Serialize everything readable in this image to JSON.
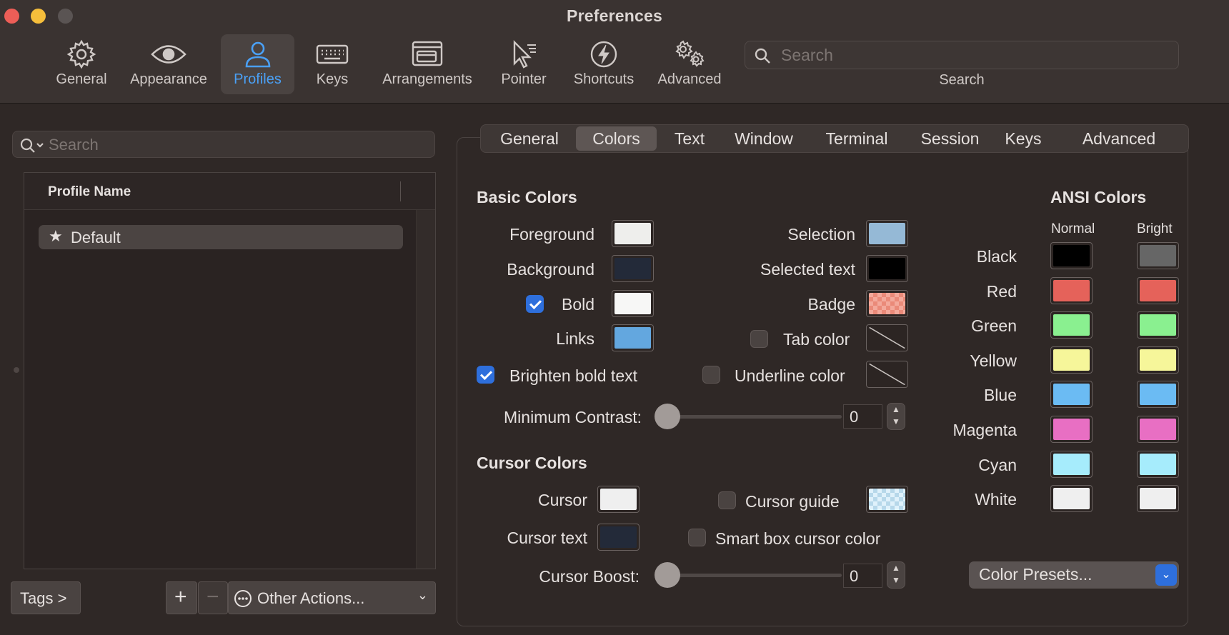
{
  "window": {
    "title": "Preferences"
  },
  "toolbar": {
    "items": [
      {
        "label": "General",
        "icon": "gear-icon"
      },
      {
        "label": "Appearance",
        "icon": "eye-icon"
      },
      {
        "label": "Profiles",
        "icon": "person-icon",
        "active": true
      },
      {
        "label": "Keys",
        "icon": "keyboard-icon"
      },
      {
        "label": "Arrangements",
        "icon": "windows-icon"
      },
      {
        "label": "Pointer",
        "icon": "cursor-icon"
      },
      {
        "label": "Shortcuts",
        "icon": "bolt-icon"
      },
      {
        "label": "Advanced",
        "icon": "gears-icon"
      }
    ],
    "search_placeholder": "Search",
    "search_caption": "Search"
  },
  "profiles": {
    "search_placeholder": "Search",
    "column_header": "Profile Name",
    "rows": [
      {
        "name": "Default",
        "is_default": true
      }
    ],
    "buttons": {
      "tags": "Tags >",
      "add": "+",
      "remove": "−",
      "other_actions": "Other Actions..."
    }
  },
  "tabs": {
    "items": [
      "General",
      "Colors",
      "Text",
      "Window",
      "Terminal",
      "Session",
      "Keys",
      "Advanced"
    ],
    "active": "Colors"
  },
  "basic_colors": {
    "title": "Basic Colors",
    "foreground": {
      "label": "Foreground",
      "color": "#eeeeec"
    },
    "background": {
      "label": "Background",
      "color": "#232a39"
    },
    "bold": {
      "label": "Bold",
      "color": "#f7f7f6",
      "checked": true
    },
    "links": {
      "label": "Links",
      "color": "#63a7df"
    },
    "brighten_bold": {
      "label": "Brighten bold text",
      "checked": true
    },
    "selection": {
      "label": "Selection",
      "color": "#95b9d6"
    },
    "selected_text": {
      "label": "Selected text",
      "color": "#000000"
    },
    "badge": {
      "label": "Badge",
      "color": "#f19585"
    },
    "tab_color": {
      "label": "Tab color",
      "checked": false
    },
    "underline_color": {
      "label": "Underline color",
      "checked": false
    },
    "minimum_contrast": {
      "label": "Minimum Contrast:",
      "value": "0"
    }
  },
  "cursor_colors": {
    "title": "Cursor Colors",
    "cursor": {
      "label": "Cursor",
      "color": "#efefef"
    },
    "cursor_text": {
      "label": "Cursor text",
      "color": "#232a39"
    },
    "cursor_guide": {
      "label": "Cursor guide",
      "checked": false
    },
    "smart_box": {
      "label": "Smart box cursor color",
      "checked": false
    },
    "cursor_boost": {
      "label": "Cursor Boost:",
      "value": "0"
    }
  },
  "ansi_colors": {
    "title": "ANSI Colors",
    "normal_label": "Normal",
    "bright_label": "Bright",
    "rows": [
      {
        "name": "Black",
        "normal": "#000000",
        "bright": "#666666"
      },
      {
        "name": "Red",
        "normal": "#e5625a",
        "bright": "#e5625a"
      },
      {
        "name": "Green",
        "normal": "#8af090",
        "bright": "#8af090"
      },
      {
        "name": "Yellow",
        "normal": "#f6f69a",
        "bright": "#f6f69a"
      },
      {
        "name": "Blue",
        "normal": "#6bbbf3",
        "bright": "#6bbbf3"
      },
      {
        "name": "Magenta",
        "normal": "#e86fc3",
        "bright": "#e86fc3"
      },
      {
        "name": "Cyan",
        "normal": "#a6ecfc",
        "bright": "#a6ecfc"
      },
      {
        "name": "White",
        "normal": "#efefef",
        "bright": "#efefef"
      }
    ],
    "presets_label": "Color Presets..."
  }
}
